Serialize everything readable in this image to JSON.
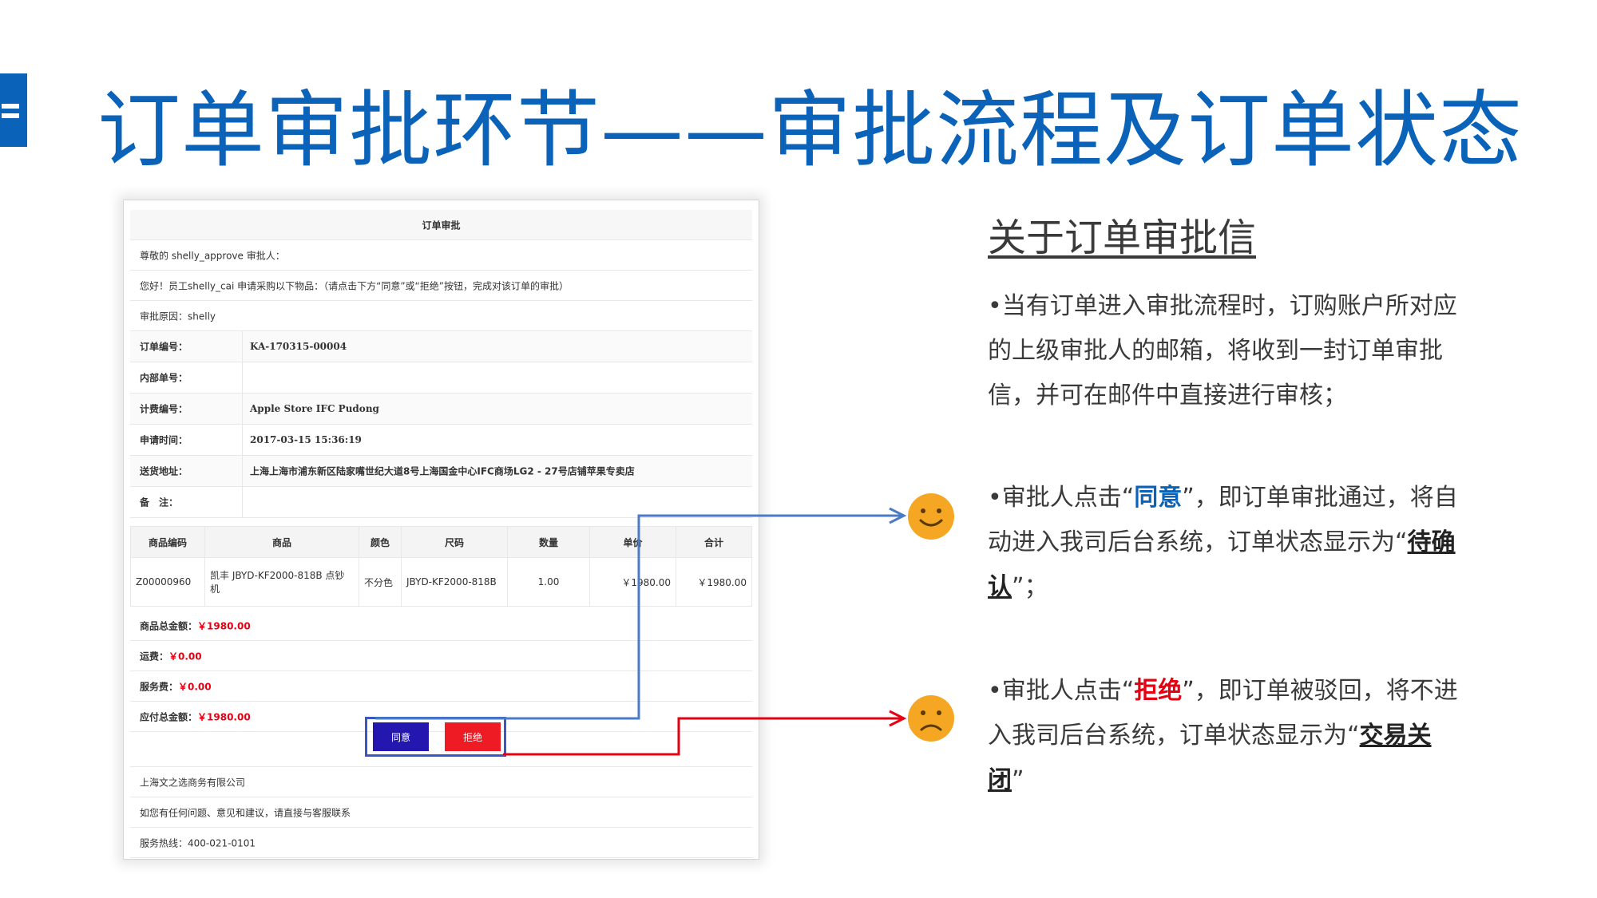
{
  "title": {
    "text": "订单审批环节——审批流程及订单状态",
    "accent_color": "#0a63b8"
  },
  "email": {
    "heading": "订单审批",
    "greeting": "尊敬的 shelly_approve 审批人：",
    "intro": "您好！员工shelly_cai 申请采购以下物品：（请点击下方“同意”或“拒绝”按钮，完成对该订单的审批）",
    "reason": "审批原因：shelly",
    "fields": [
      {
        "label": "订单编号：",
        "value": "KA-170315-00004"
      },
      {
        "label": "内部单号：",
        "value": ""
      },
      {
        "label": "计费编号：",
        "value": "Apple Store IFC Pudong"
      },
      {
        "label": "申请时间：",
        "value": "2017-03-15 15:36:19"
      },
      {
        "label": "送货地址：",
        "value": "上海上海市浦东新区陆家嘴世纪大道8号上海国金中心IFC商场LG2 - 27号店铺苹果专卖店"
      },
      {
        "label": "备　注：",
        "value": ""
      }
    ],
    "table": {
      "headers": [
        "商品编码",
        "商品",
        "颜色",
        "尺码",
        "数量",
        "单价",
        "合计"
      ],
      "rows": [
        [
          "Z00000960",
          "凯丰 JBYD-KF2000-818B 点钞机",
          "不分色",
          "JBYD-KF2000-818B",
          "1.00",
          "￥1980.00",
          "￥1980.00"
        ]
      ]
    },
    "summary": [
      {
        "label": "商品总金额：",
        "value": "￥1980.00"
      },
      {
        "label": "运费：",
        "value": "￥0.00"
      },
      {
        "label": "服务费：",
        "value": "￥0.00"
      },
      {
        "label": "应付总金额：",
        "value": "￥1980.00"
      }
    ],
    "agree_button": "同意",
    "reject_button": "拒绝",
    "footer": {
      "company": "上海文之选商务有限公司",
      "contact_note": "如您有任何问题、意见和建议，请直接与客服联系",
      "hotline": "服务热线：400-021-0101"
    }
  },
  "arrows": {
    "agree_color": "#4a7bc4",
    "reject_color": "#e60012"
  },
  "emojis": {
    "happy": "smile-face-icon",
    "sad": "sad-face-icon",
    "color": "#f5a623"
  },
  "info": {
    "title": "关于订单审批信",
    "p1": "•当有订单进入审批流程时，订购账户所对应的上级审批人的邮箱，将收到一封订单审批信，并可在邮件中直接进行审核；",
    "p2_pre": "•审批人点击“",
    "p2_key": "同意",
    "p2_mid": "”，即订单审批通过，将自动进入我司后台系统，订单状态显示为“",
    "p2_status": "待确认",
    "p2_end": "”；",
    "p3_pre": "•审批人点击“",
    "p3_key": "拒绝",
    "p3_mid": "”，即订单被驳回，将不进入我司后台系统，订单状态显示为“",
    "p3_status": "交易关闭",
    "p3_end": "”"
  }
}
